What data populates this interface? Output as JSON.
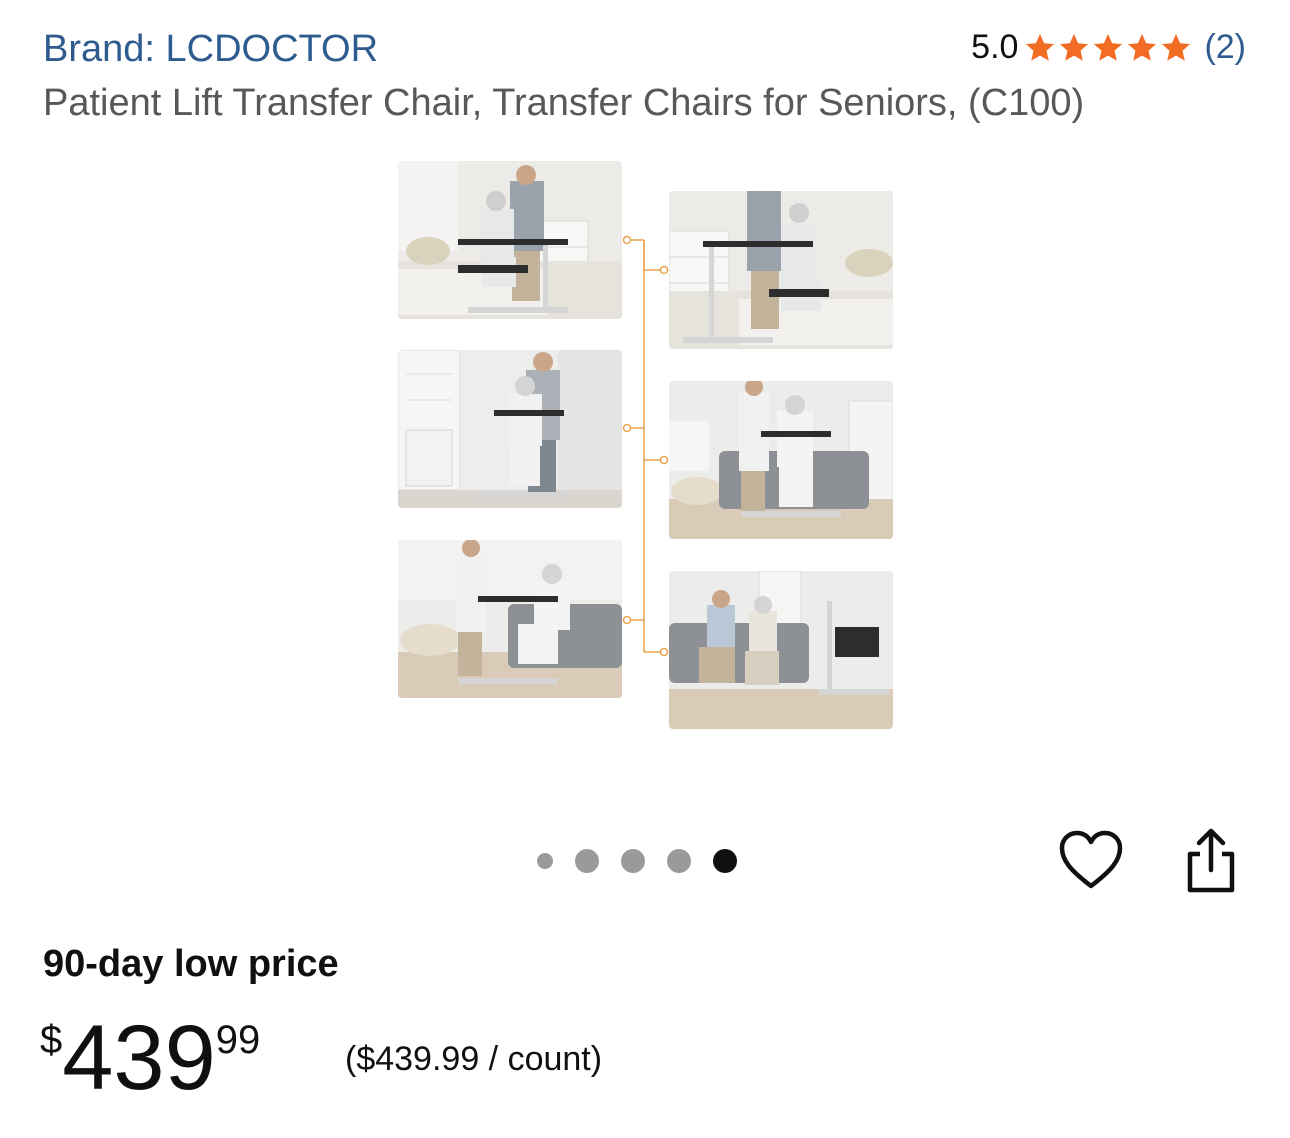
{
  "header": {
    "brand": "Brand: LCDOCTOR",
    "rating_score": "5.0",
    "rating_stars": 5,
    "rating_count": "(2)",
    "title": "Patient Lift Transfer Chair, Transfer Chairs for Seniors, (C100)"
  },
  "gallery": {
    "photos": [
      {
        "name": "photo-bedside-seated"
      },
      {
        "name": "photo-bedside-standing"
      },
      {
        "name": "photo-transfer-chair-hallway"
      },
      {
        "name": "photo-living-room-transfer"
      },
      {
        "name": "photo-sofa-transfer"
      },
      {
        "name": "photo-sofa-seated-couple"
      }
    ],
    "dots_total": 5,
    "dots_active_index": 4
  },
  "actions": {
    "heart_icon": "heart-icon",
    "share_icon": "share-icon"
  },
  "pricing": {
    "deal_label": "90-day low price",
    "currency_symbol": "$",
    "price_whole": "439",
    "price_fraction": "99",
    "unit_price": "($439.99 / count)"
  },
  "colors": {
    "link": "#2f5c8f",
    "star": "#f36c23",
    "connector": "#e8a34e"
  }
}
